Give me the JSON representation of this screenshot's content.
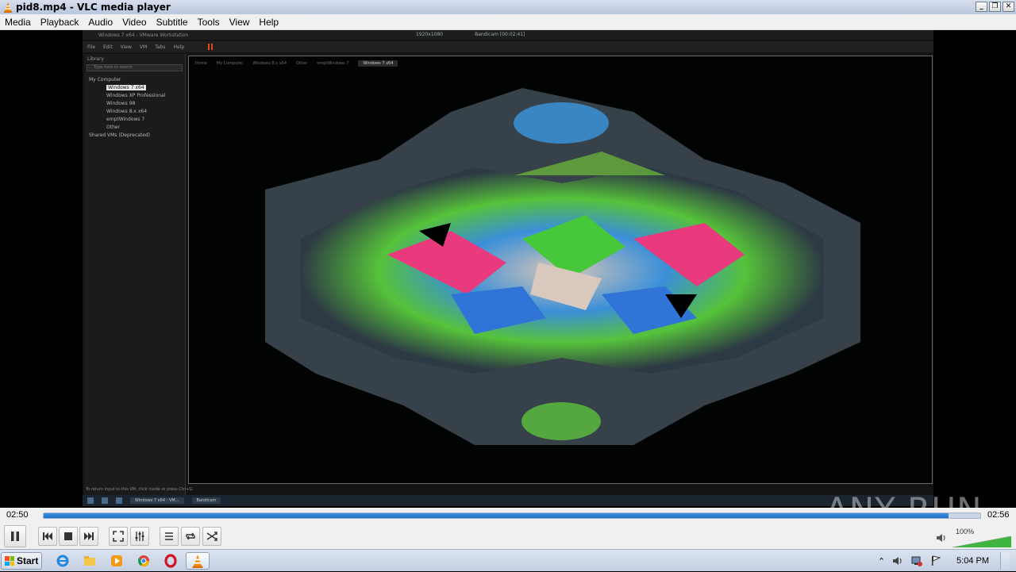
{
  "window": {
    "title": "pid8.mp4 - VLC media player",
    "controls": {
      "minimize": "_",
      "restore": "❐",
      "close": "✕"
    }
  },
  "menu": [
    "Media",
    "Playback",
    "Audio",
    "Video",
    "Subtitle",
    "Tools",
    "View",
    "Help"
  ],
  "player": {
    "elapsed": "02:50",
    "total": "02:56",
    "progress": 0.966,
    "volume_percent": "100%",
    "volume_level": 1.0
  },
  "video_frame": {
    "vm_title": "Windows 7 x64 - VMware Workstation",
    "vm_resolution": "1920x1080",
    "vm_recording": "Bandicam [00:02:41]",
    "vm_menu": [
      "File",
      "Edit",
      "View",
      "VM",
      "Tabs",
      "Help"
    ],
    "library_header": "Library",
    "library_search": "Type here to search",
    "tree": [
      {
        "label": "My Computer",
        "level": 0
      },
      {
        "label": "Windows 7 x64",
        "level": 1,
        "selected": true
      },
      {
        "label": "Windows XP Professional",
        "level": 1
      },
      {
        "label": "Windows 98",
        "level": 1
      },
      {
        "label": "Windows 8.x x64",
        "level": 1
      },
      {
        "label": "emptWindows 7",
        "level": 1
      },
      {
        "label": "Other",
        "level": 1
      },
      {
        "label": "Shared VMs (Deprecated)",
        "level": 0
      }
    ],
    "tabs": [
      "Home",
      "My Computer",
      "Windows 8.x x64",
      "Other",
      "emptWindows 7",
      "Windows 7 x64"
    ],
    "active_tab": "Windows 7 x64",
    "status_text": "To return input to this VM, click inside or press Ctrl+G.",
    "taskbar_tasks": [
      "Windows 7 x64 - VM...",
      "Bandicam"
    ]
  },
  "watermark": "ANY RUN",
  "taskbar": {
    "start_label": "Start",
    "pinned": [
      "ie-icon",
      "explorer-icon",
      "media-player-icon",
      "chrome-icon",
      "opera-icon",
      "vlc-icon"
    ],
    "clock": "5:04 PM"
  },
  "colors": {
    "accent": "#1f6fc8",
    "vlc_orange": "#f08a00",
    "taskbar": "#c3cfe2"
  }
}
